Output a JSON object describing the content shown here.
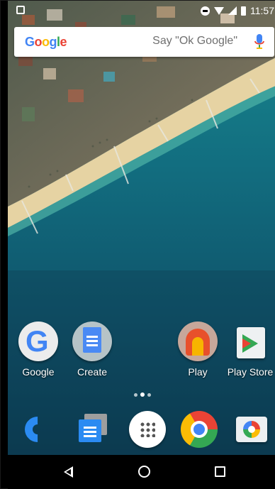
{
  "status_bar": {
    "time": "11:57"
  },
  "search": {
    "logo": "Google",
    "hint": "Say \"Ok Google\"",
    "mic_icon": "mic-icon"
  },
  "home_apps": [
    {
      "label": "Google",
      "icon": "google-app-icon"
    },
    {
      "label": "Create",
      "icon": "docs-create-icon"
    },
    {
      "label": "Play",
      "icon": "play-app-icon"
    },
    {
      "label": "Play Store",
      "icon": "play-store-icon"
    }
  ],
  "page_indicator": {
    "pages": 3,
    "active": 2
  },
  "dock": [
    {
      "icon": "phone-icon"
    },
    {
      "icon": "messages-icon"
    },
    {
      "icon": "all-apps-icon"
    },
    {
      "icon": "chrome-icon"
    },
    {
      "icon": "camera-icon"
    }
  ],
  "navigation": [
    "back-icon",
    "home-icon",
    "recents-icon"
  ],
  "colors": {
    "google_blue": "#4285F4",
    "google_red": "#EA4335",
    "google_yellow": "#FBBC05",
    "google_green": "#34A853",
    "dock_blue": "#2b8bf2"
  }
}
